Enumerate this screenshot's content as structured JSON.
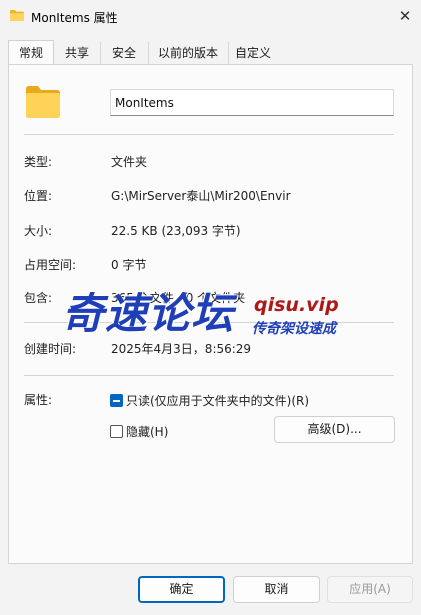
{
  "window": {
    "title": "MonItems 属性",
    "close_glyph": "✕",
    "icon": "folder-icon"
  },
  "tabs": [
    {
      "label": "常规",
      "active": true
    },
    {
      "label": "共享"
    },
    {
      "label": "安全"
    },
    {
      "label": "以前的版本"
    },
    {
      "label": "自定义"
    }
  ],
  "general": {
    "name_value": "MonItems",
    "rows": {
      "type": {
        "label": "类型:",
        "value": "文件夹"
      },
      "location": {
        "label": "位置:",
        "value": "G:\\MirServer泰山\\Mir200\\Envir"
      },
      "size": {
        "label": "大小:",
        "value": "22.5 KB (23,093 字节)"
      },
      "size_on_disk": {
        "label": "占用空间:",
        "value": "0 字节"
      },
      "contains": {
        "label": "包含:",
        "value": "365 个文件，0 个文件夹"
      },
      "created": {
        "label": "创建时间:",
        "value": "2025年4月3日，8:56:29"
      }
    },
    "attributes": {
      "label": "属性:",
      "readonly_label": "只读(仅应用于文件夹中的文件)(R)",
      "readonly_state": "indeterminate",
      "hidden_label": "隐藏(H)",
      "hidden_checked": false,
      "advanced_label": "高级(D)..."
    }
  },
  "watermark": {
    "main": "奇速论坛",
    "url": "qisu.vip",
    "sub": "传奇架设速成"
  },
  "footer": {
    "ok_label": "确定",
    "cancel_label": "取消",
    "apply_label": "应用(A)"
  },
  "colors": {
    "accent": "#0067c0",
    "folder": "#f5c842",
    "watermark_blue": "#1f3fb8",
    "watermark_red": "#b01818"
  }
}
